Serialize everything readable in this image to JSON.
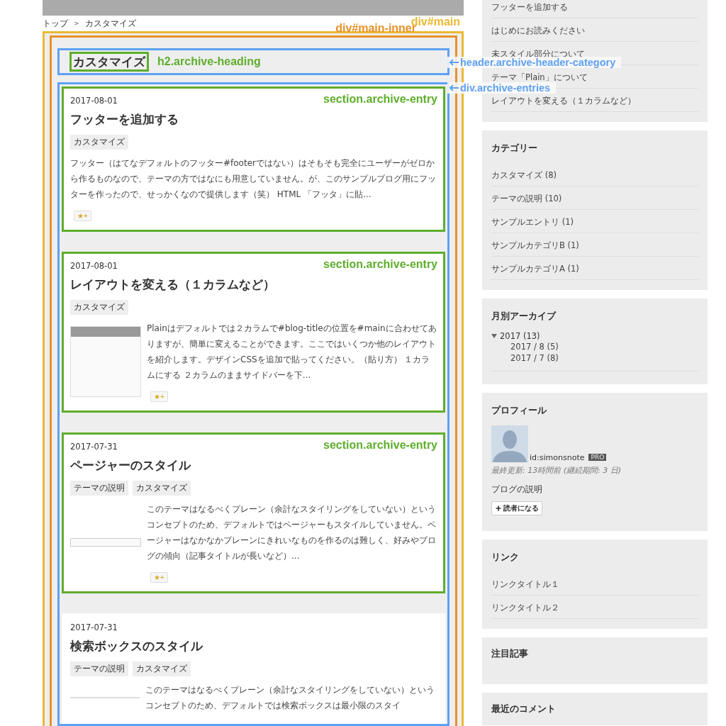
{
  "breadcrumb": {
    "items": [
      "トップ",
      "カスタマイズ"
    ],
    "separator": ">"
  },
  "main": {
    "annotation": {
      "label": "div#main",
      "color": "#ecb832"
    },
    "inner_annotation": {
      "label": "div#main-inner",
      "color": "#e8912a"
    },
    "header": {
      "heading": "カスタマイズ",
      "heading_annotation": {
        "label": "h2.archive-heading",
        "color": "#5eae2c"
      },
      "annotation": {
        "label": "header.archive-header-category",
        "color": "#5ea1f2"
      }
    },
    "entries_annotation": {
      "label": "div.archive-entries",
      "color": "#5ea1f2"
    },
    "entries": [
      {
        "date": "2017-08-01",
        "title": "フッターを追加する",
        "categories": [
          "カスタマイズ"
        ],
        "summary": "フッター（はてなデフォルトのフッター#footerではない）はそもそも完全にユーザーがゼロから作るものなので、テーマの方ではなにも用意していません。が、このサンプルブログ用にフッターを作ったので、せっかくなので提供します（笑） HTML 「フッタ」に貼...",
        "star": "★+",
        "annotation": {
          "label": "section.archive-entry",
          "color": "#5eae2c"
        }
      },
      {
        "date": "2017-08-01",
        "title": "レイアウトを変える（１カラムなど）",
        "categories": [
          "カスタマイズ"
        ],
        "thumbnail": {
          "kind": "page"
        },
        "summary": "Plainはデフォルトでは２カラムで#blog-titleの位置を#mainに合わせてありますが、簡単に変えることができます。ここではいくつか他のレイアウトを紹介します。デザインCSSを追加で貼ってください。（貼り方） １カラムにする ２カラムのままサイドバーを下...",
        "star": "★+",
        "annotation": {
          "label": "section.archive-entry",
          "color": "#5eae2c"
        }
      },
      {
        "date": "2017-07-31",
        "title": "ページャーのスタイル",
        "categories": [
          "テーマの説明",
          "カスタマイズ"
        ],
        "thumbnail": {
          "kind": "strip"
        },
        "summary": "このテーマはなるべくプレーン（余計なスタイリングをしていない）というコンセプトのため、デフォルトではページャーもスタイルしていません。ページャーはなかなかプレーンにきれいなものを作るのは難しく、好みやブログの傾向（記事タイトルが長いなど）...",
        "star": "★+",
        "annotation": {
          "label": "section.archive-entry",
          "color": "#5eae2c"
        }
      },
      {
        "date": "2017-07-31",
        "title": "検索ボックスのスタイル",
        "categories": [
          "テーマの説明",
          "カスタマイズ"
        ],
        "thumbnail": {
          "kind": "line"
        },
        "summary": "このテーマはなるべくプレーン（余計なスタイリングをしていない）というコンセプトのため、デフォルトでは検索ボックスは最小限のスタイ"
      }
    ]
  },
  "sidebar": [
    {
      "kind": "list",
      "items": [
        "フッターを追加する",
        "はじめにお読みください",
        "未スタイル部分について",
        "テーマ「Plain」について",
        "レイアウトを変える（１カラムなど）"
      ]
    },
    {
      "kind": "list",
      "title": "カテゴリー",
      "items": [
        "カスタマイズ (8)",
        "テーマの説明 (10)",
        "サンプルエントリ (1)",
        "サンプルカテゴリB (1)",
        "サンプルカテゴリA (1)"
      ]
    },
    {
      "kind": "archive",
      "title": "月別アーカイブ",
      "years": [
        {
          "label": "2017 (13)",
          "expanded": true,
          "months": [
            "2017 / 8 (5)",
            "2017 / 7 (8)"
          ]
        }
      ]
    },
    {
      "kind": "profile",
      "title": "プロフィール",
      "user": "id:simonsnote",
      "badge": "PRO",
      "updated": "最終更新: 13時間前 (継続期間: 3 日)",
      "description": "ブログの説明",
      "subscribe": "読者になる"
    },
    {
      "kind": "list",
      "title": "リンク",
      "items": [
        "リンクタイトル１",
        "リンクタイトル２"
      ]
    },
    {
      "kind": "empty",
      "title": "注目記事"
    },
    {
      "kind": "cut",
      "title": "最近のコメント"
    }
  ]
}
